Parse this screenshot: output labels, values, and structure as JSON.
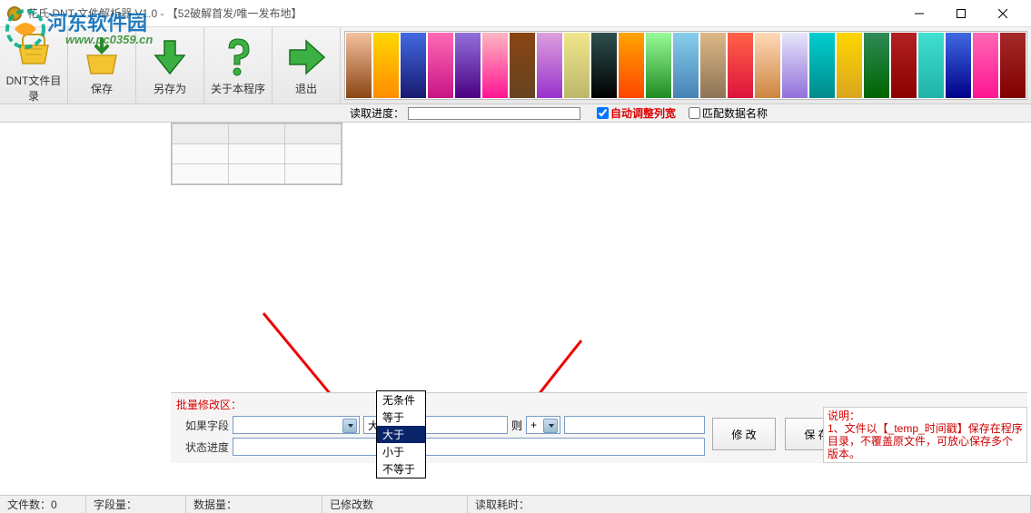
{
  "window": {
    "title": "花氏 DNT 文件解析器 V1.0  - 【52破解首发/唯一发布地】"
  },
  "watermark": {
    "text": "河东软件园",
    "url": "www.pc0359.cn"
  },
  "toolbar": {
    "open_label": "DNT文件目录",
    "save_label": "保存",
    "saveas_label": "另存为",
    "about_label": "关于本程序",
    "exit_label": "退出"
  },
  "options": {
    "progress_label": "读取进度：",
    "auto_width_label": "自动调整列宽",
    "auto_width_checked": true,
    "match_name_label": "匹配数据名称",
    "match_name_checked": false
  },
  "batch": {
    "section_title": "批量修改区：",
    "if_label": "如果字段",
    "cond_field_value": "",
    "cond_op_value": "大于",
    "cond_value": "",
    "then_label": "则",
    "then_op_value": "+",
    "then_value": "",
    "status_label": "状态进度",
    "status_value": "",
    "modify_btn": "修 改",
    "save_btn": "保 存"
  },
  "dropdown_options": [
    "无条件",
    "等于",
    "大于",
    "小于",
    "不等于"
  ],
  "dropdown_selected_index": 2,
  "info": {
    "header": "说明：",
    "line1": "1、文件以【_temp_时间戳】保存在程序目录，不覆盖原文件，可放心保存多个版本。"
  },
  "status": {
    "files": "文件数：0",
    "fields": "字段量：",
    "rows": "数据量：",
    "modified": "已修改数",
    "elapsed": "读取耗时："
  }
}
